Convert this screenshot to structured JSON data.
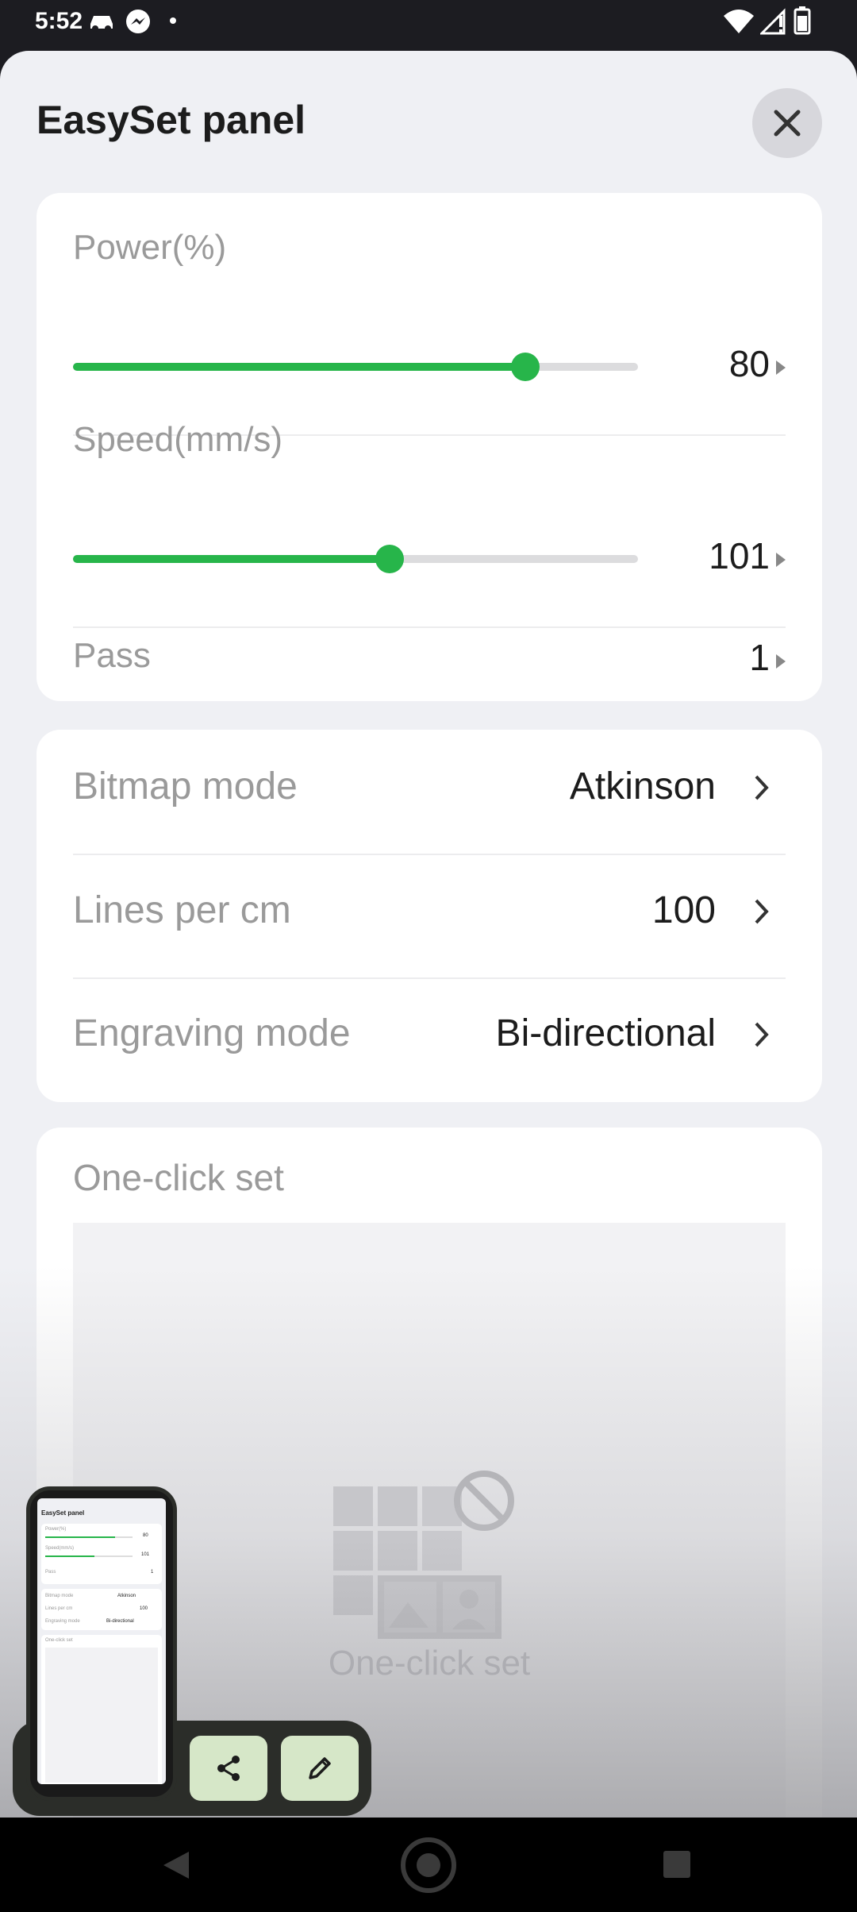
{
  "status_bar": {
    "time": "5:52"
  },
  "panel": {
    "title": "EasySet panel",
    "power": {
      "label": "Power(%)",
      "value": "80",
      "level_percent": 80
    },
    "speed": {
      "label": "Speed(mm/s)",
      "value": "101",
      "level_percent": 56
    },
    "pass": {
      "label": "Pass",
      "value": "1"
    },
    "bitmap_mode": {
      "label": "Bitmap mode",
      "value": "Atkinson"
    },
    "lines_per_cm": {
      "label": "Lines per cm",
      "value": "100"
    },
    "engraving_mode": {
      "label": "Engraving mode",
      "value": "Bi-directional"
    },
    "one_click": {
      "label": "One-click set",
      "empty_text": "One-click set"
    }
  },
  "colors": {
    "accent": "#27b54a",
    "sheet": "#eff0f4",
    "card": "#ffffff",
    "share_button": "#d6e7c8"
  },
  "preview_icons": [
    "share-icon",
    "pencil-icon"
  ],
  "nav_icons": [
    "back-icon",
    "home-icon",
    "recents-icon"
  ]
}
